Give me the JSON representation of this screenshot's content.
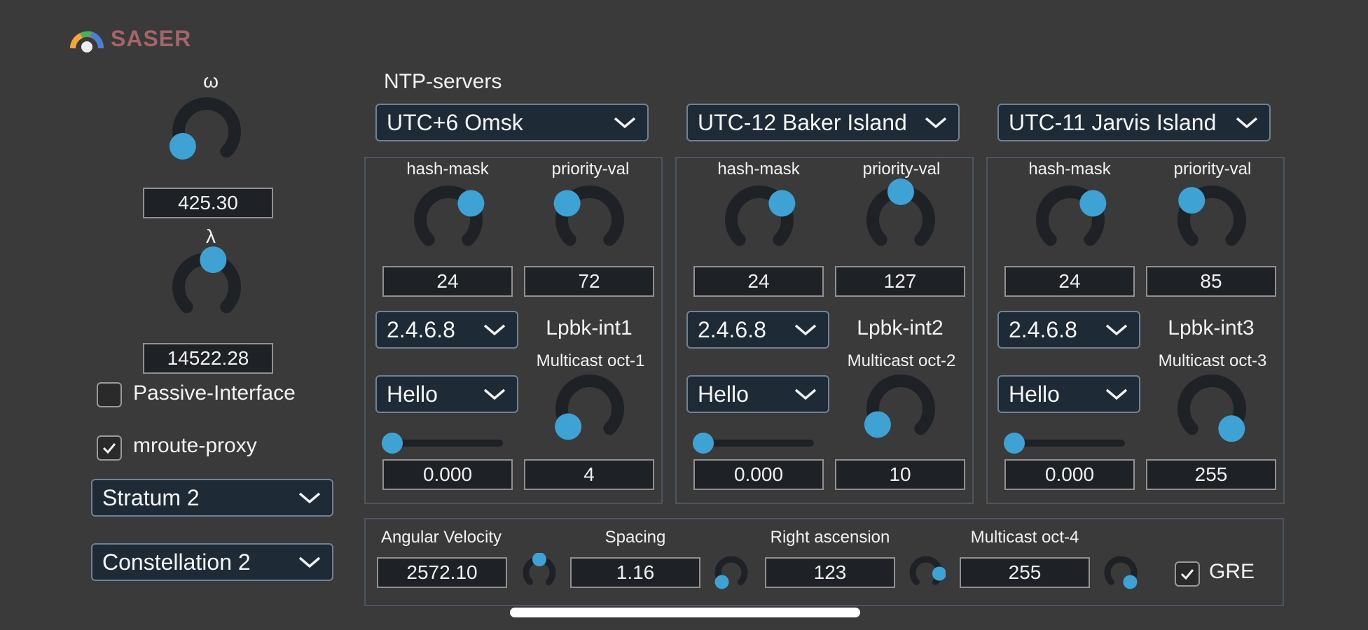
{
  "app": {
    "logo_text": "SASER"
  },
  "colors": {
    "background": "#3a3a3a",
    "knob_track": "#1e2226",
    "knob_thumb": "#3ea3d4",
    "logo": "#a5636c",
    "dropdown_bg": "#1e2b36"
  },
  "left": {
    "omega": {
      "label": "ω",
      "value": "425.30",
      "level": 0.05
    },
    "lambda": {
      "label": "λ",
      "value": "14522.28",
      "level": 0.55
    },
    "passive_interface": {
      "label": "Passive-Interface",
      "checked": false
    },
    "mroute_proxy": {
      "label": "mroute-proxy",
      "checked": true
    },
    "stratum": {
      "selected": "Stratum 2"
    },
    "constellation": {
      "selected": "Constellation 2"
    }
  },
  "ntp": {
    "title": "NTP-servers",
    "servers": [
      {
        "zone": "UTC+6 Omsk",
        "hash_label": "hash-mask",
        "hash_value": "24",
        "hash_level": 0.7,
        "priority_label": "priority-val",
        "priority_value": "72",
        "priority_level": 0.3,
        "ip": "2.4.6.8",
        "lpbk": "Lpbk-int1",
        "hello": "Hello",
        "slider_value": "0.000",
        "slider_level": 0.0,
        "mc_label": "Multicast oct-1",
        "mc_value": "4",
        "mc_level": 0.02
      },
      {
        "zone": "UTC-12 Baker Island",
        "hash_label": "hash-mask",
        "hash_value": "24",
        "hash_level": 0.7,
        "priority_label": "priority-val",
        "priority_value": "127",
        "priority_level": 0.5,
        "ip": "2.4.6.8",
        "lpbk": "Lpbk-int2",
        "hello": "Hello",
        "slider_value": "0.000",
        "slider_level": 0.0,
        "mc_label": "Multicast oct-2",
        "mc_value": "10",
        "mc_level": 0.04
      },
      {
        "zone": "UTC-11 Jarvis Island",
        "hash_label": "hash-mask",
        "hash_value": "24",
        "hash_level": 0.7,
        "priority_label": "priority-val",
        "priority_value": "85",
        "priority_level": 0.33,
        "ip": "2.4.6.8",
        "lpbk": "Lpbk-int3",
        "hello": "Hello",
        "slider_value": "0.000",
        "slider_level": 0.0,
        "mc_label": "Multicast oct-3",
        "mc_value": "255",
        "mc_level": 1.0
      }
    ]
  },
  "bottom": {
    "angular_velocity": {
      "label": "Angular Velocity",
      "value": "2572.10",
      "level": 0.5
    },
    "spacing": {
      "label": "Spacing",
      "value": "1.16",
      "level": 0.0
    },
    "right_ascension": {
      "label": "Right ascension",
      "value": "123",
      "level": 0.85
    },
    "multicast_oct4": {
      "label": "Multicast oct-4",
      "value": "255",
      "level": 1.0
    },
    "gre": {
      "label": "GRE",
      "checked": true
    }
  }
}
